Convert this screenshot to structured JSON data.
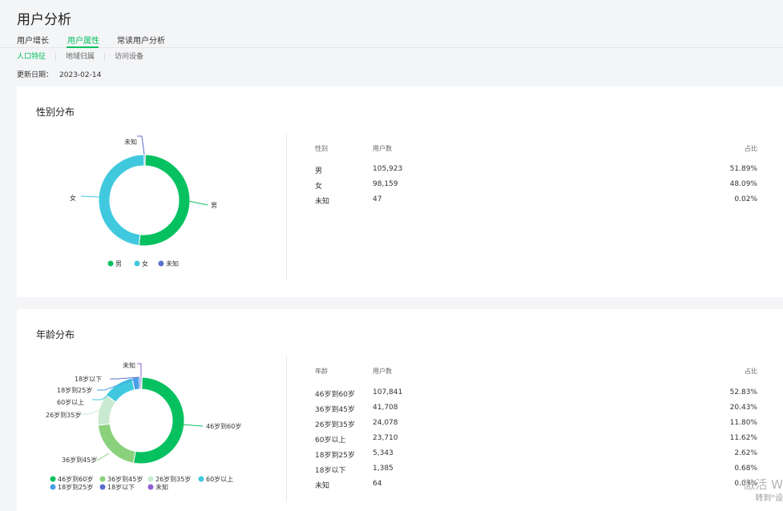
{
  "page": {
    "title": "用户分析",
    "update_label": "更新日期：",
    "update_date": "2023-02-14"
  },
  "tabs": [
    {
      "label": "用户增长",
      "active": false
    },
    {
      "label": "用户属性",
      "active": true
    },
    {
      "label": "常读用户分析",
      "active": false
    }
  ],
  "subtabs": [
    {
      "label": "人口特征",
      "active": true
    },
    {
      "label": "地域归属",
      "active": false
    },
    {
      "label": "访问设备",
      "active": false
    }
  ],
  "gender": {
    "title": "性别分布",
    "columns": [
      "性别",
      "用户数",
      "占比"
    ],
    "rows": [
      {
        "label": "男",
        "count": "105,923",
        "pct": "51.89%"
      },
      {
        "label": "女",
        "count": "98,159",
        "pct": "48.09%"
      },
      {
        "label": "未知",
        "count": "47",
        "pct": "0.02%"
      }
    ],
    "legend": [
      "男",
      "女",
      "未知"
    ]
  },
  "age": {
    "title": "年龄分布",
    "columns": [
      "年龄",
      "用户数",
      "占比"
    ],
    "rows": [
      {
        "label": "46岁到60岁",
        "count": "107,841",
        "pct": "52.83%"
      },
      {
        "label": "36岁到45岁",
        "count": "41,708",
        "pct": "20.43%"
      },
      {
        "label": "26岁到35岁",
        "count": "24,078",
        "pct": "11.80%"
      },
      {
        "label": "60岁以上",
        "count": "23,710",
        "pct": "11.62%"
      },
      {
        "label": "18岁到25岁",
        "count": "5,343",
        "pct": "2.62%"
      },
      {
        "label": "18岁以下",
        "count": "1,385",
        "pct": "0.68%"
      },
      {
        "label": "未知",
        "count": "64",
        "pct": "0.03%"
      }
    ],
    "legend": [
      "46岁到60岁",
      "36岁到45岁",
      "26岁到35岁",
      "60岁以上",
      "18岁到25岁",
      "18岁以下",
      "未知"
    ]
  },
  "chart_data": [
    {
      "type": "pie",
      "title": "性别分布",
      "categories": [
        "男",
        "女",
        "未知"
      ],
      "values": [
        51.89,
        48.09,
        0.02
      ],
      "colors": [
        "#07c160",
        "#40c9de",
        "#5b6fcf"
      ],
      "legend_position": "bottom"
    },
    {
      "type": "pie",
      "title": "年龄分布",
      "categories": [
        "46岁到60岁",
        "36岁到45岁",
        "26岁到35岁",
        "60岁以上",
        "18岁到25岁",
        "18岁以下",
        "未知"
      ],
      "values": [
        52.83,
        20.43,
        11.8,
        11.62,
        2.62,
        0.68,
        0.03
      ],
      "colors": [
        "#07c160",
        "#8ad17c",
        "#c9ead1",
        "#40c9de",
        "#4a9ee6",
        "#5b6fcf",
        "#8e5fd0"
      ],
      "legend_position": "bottom"
    }
  ],
  "watermark": {
    "line1": "激活 W",
    "line2": "转到\"设"
  }
}
